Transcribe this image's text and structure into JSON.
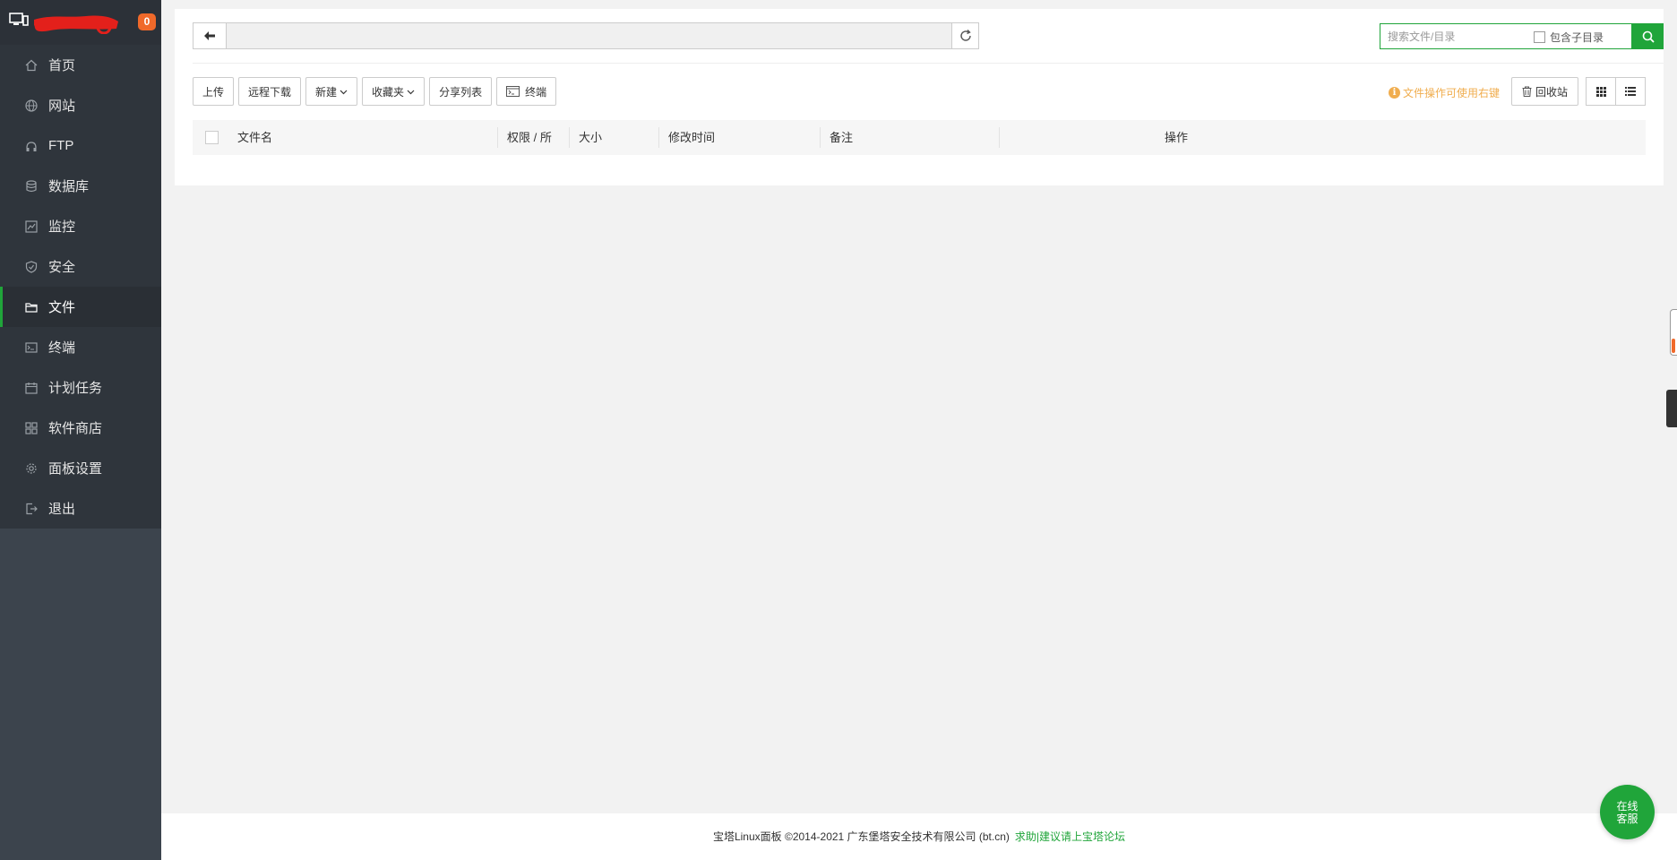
{
  "sidebar": {
    "badge": "0",
    "items": [
      {
        "label": "首页",
        "icon": "home-icon"
      },
      {
        "label": "网站",
        "icon": "globe-icon"
      },
      {
        "label": "FTP",
        "icon": "ftp-icon"
      },
      {
        "label": "数据库",
        "icon": "database-icon"
      },
      {
        "label": "监控",
        "icon": "monitor-chart-icon"
      },
      {
        "label": "安全",
        "icon": "shield-icon"
      },
      {
        "label": "文件",
        "icon": "folder-icon",
        "active": true
      },
      {
        "label": "终端",
        "icon": "terminal-icon"
      },
      {
        "label": "计划任务",
        "icon": "calendar-icon"
      },
      {
        "label": "软件商店",
        "icon": "apps-icon"
      },
      {
        "label": "面板设置",
        "icon": "gear-icon"
      },
      {
        "label": "退出",
        "icon": "logout-icon"
      }
    ]
  },
  "pathbar": {
    "path": ""
  },
  "search": {
    "placeholder": "搜索文件/目录",
    "include_subdir_label": "包含子目录"
  },
  "toolbar": {
    "upload": "上传",
    "remote_download": "远程下载",
    "new": "新建",
    "favorites": "收藏夹",
    "share_list": "分享列表",
    "terminal": "终端"
  },
  "tip": "文件操作可使用右键",
  "recycle_bin": "回收站",
  "table": {
    "columns": [
      "文件名",
      "权限 / 所",
      "大小",
      "修改时间",
      "备注",
      "操作"
    ]
  },
  "footer": {
    "copyright": "宝塔Linux面板 ©2014-2021 广东堡塔安全技术有限公司 (bt.cn)",
    "link": "求助|建议请上宝塔论坛"
  },
  "online_service": {
    "line1": "在线",
    "line2": "客服"
  },
  "colors": {
    "accent": "#20a53a",
    "sidebar": "#3c444d",
    "badge": "#f0692a",
    "tip": "#f0ad4e"
  }
}
